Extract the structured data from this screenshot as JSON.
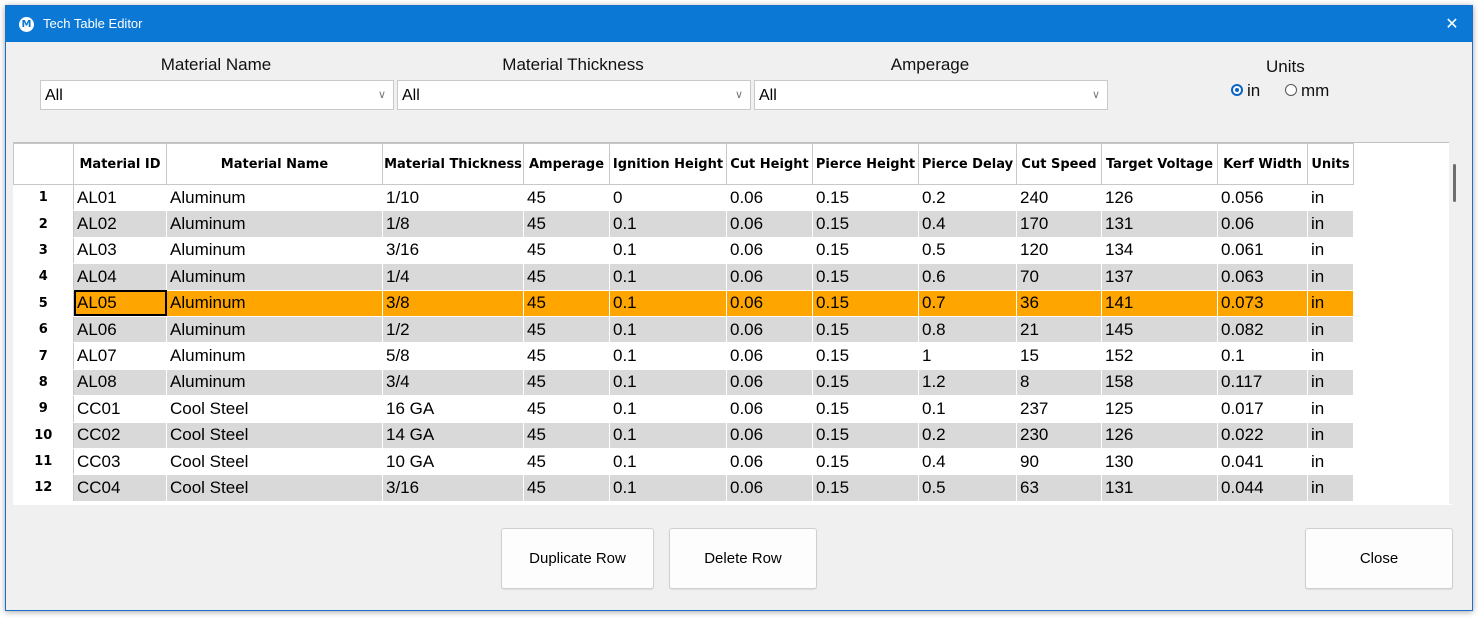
{
  "window": {
    "title": "Tech Table Editor",
    "app_icon_letter": "M",
    "close_glyph": "✕"
  },
  "filters": {
    "material_name": {
      "label": "Material Name",
      "value": "All"
    },
    "material_thickness": {
      "label": "Material Thickness",
      "value": "All"
    },
    "amperage": {
      "label": "Amperage",
      "value": "All"
    }
  },
  "units": {
    "label": "Units",
    "options": [
      "in",
      "mm"
    ],
    "selected": "in"
  },
  "table": {
    "columns": [
      "Material ID",
      "Material Name",
      "Material Thickness",
      "Amperage",
      "Ignition Height",
      "Cut Height",
      "Pierce Height",
      "Pierce Delay",
      "Cut Speed",
      "Target Voltage",
      "Kerf Width",
      "Units"
    ],
    "selected_row": 5,
    "rows": [
      {
        "num": "1",
        "cells": [
          "AL01",
          "Aluminum",
          "1/10",
          "45",
          "0",
          "0.06",
          "0.15",
          "0.2",
          "240",
          "126",
          "0.056",
          "in"
        ]
      },
      {
        "num": "2",
        "cells": [
          "AL02",
          "Aluminum",
          "1/8",
          "45",
          "0.1",
          "0.06",
          "0.15",
          "0.4",
          "170",
          "131",
          "0.06",
          "in"
        ]
      },
      {
        "num": "3",
        "cells": [
          "AL03",
          "Aluminum",
          "3/16",
          "45",
          "0.1",
          "0.06",
          "0.15",
          "0.5",
          "120",
          "134",
          "0.061",
          "in"
        ]
      },
      {
        "num": "4",
        "cells": [
          "AL04",
          "Aluminum",
          "1/4",
          "45",
          "0.1",
          "0.06",
          "0.15",
          "0.6",
          "70",
          "137",
          "0.063",
          "in"
        ]
      },
      {
        "num": "5",
        "cells": [
          "AL05",
          "Aluminum",
          "3/8",
          "45",
          "0.1",
          "0.06",
          "0.15",
          "0.7",
          "36",
          "141",
          "0.073",
          "in"
        ]
      },
      {
        "num": "6",
        "cells": [
          "AL06",
          "Aluminum",
          "1/2",
          "45",
          "0.1",
          "0.06",
          "0.15",
          "0.8",
          "21",
          "145",
          "0.082",
          "in"
        ]
      },
      {
        "num": "7",
        "cells": [
          "AL07",
          "Aluminum",
          "5/8",
          "45",
          "0.1",
          "0.06",
          "0.15",
          "1",
          "15",
          "152",
          "0.1",
          "in"
        ]
      },
      {
        "num": "8",
        "cells": [
          "AL08",
          "Aluminum",
          "3/4",
          "45",
          "0.1",
          "0.06",
          "0.15",
          "1.2",
          "8",
          "158",
          "0.117",
          "in"
        ]
      },
      {
        "num": "9",
        "cells": [
          "CC01",
          "Cool Steel",
          "16 GA",
          "45",
          "0.1",
          "0.06",
          "0.15",
          "0.1",
          "237",
          "125",
          "0.017",
          "in"
        ]
      },
      {
        "num": "10",
        "cells": [
          "CC02",
          "Cool Steel",
          "14 GA",
          "45",
          "0.1",
          "0.06",
          "0.15",
          "0.2",
          "230",
          "126",
          "0.022",
          "in"
        ]
      },
      {
        "num": "11",
        "cells": [
          "CC03",
          "Cool Steel",
          "10 GA",
          "45",
          "0.1",
          "0.06",
          "0.15",
          "0.4",
          "90",
          "130",
          "0.041",
          "in"
        ]
      },
      {
        "num": "12",
        "cells": [
          "CC04",
          "Cool Steel",
          "3/16",
          "45",
          "0.1",
          "0.06",
          "0.15",
          "0.5",
          "63",
          "131",
          "0.044",
          "in"
        ]
      }
    ]
  },
  "buttons": {
    "duplicate": "Duplicate Row",
    "delete": "Delete Row",
    "close": "Close"
  },
  "colors": {
    "title_bar": "#0a78d4",
    "selected_row": "#ffa500",
    "alt_row": "#d9d9d9"
  }
}
